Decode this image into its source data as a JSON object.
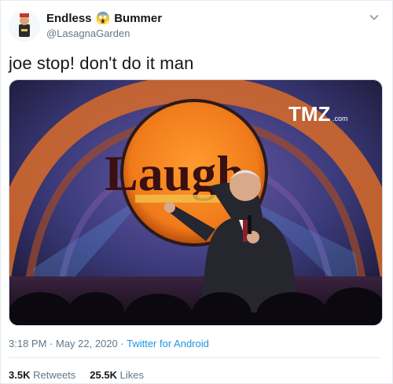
{
  "author": {
    "display_name_part1": "Endless",
    "display_name_emoji": "😱",
    "display_name_part2": "Bummer",
    "handle": "@LasagnaGarden"
  },
  "tweet": {
    "text": "joe stop! don't do it man"
  },
  "media": {
    "sign_text": "Laugh",
    "watermark": "TMZ",
    "watermark_suffix": ".com"
  },
  "meta": {
    "time": "3:18 PM",
    "date": "May 22, 2020",
    "source": "Twitter for Android",
    "separator": " · "
  },
  "stats": {
    "retweets_count": "3.5K",
    "retweets_label": "Retweets",
    "likes_count": "25.5K",
    "likes_label": "Likes"
  },
  "colors": {
    "link": "#1b95e0",
    "secondary_text": "#657786",
    "primary_text": "#14171a",
    "sign_orange": "#f07a1a"
  },
  "icons": {
    "caret": "chevron-down-icon",
    "avatar": "avatar"
  }
}
